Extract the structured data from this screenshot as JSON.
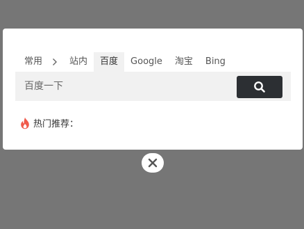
{
  "background": {
    "blurred_title": ""
  },
  "search_engine_panel": {
    "tabs": [
      {
        "label": "常用",
        "active": false,
        "group": true
      },
      {
        "label": "站内",
        "active": false
      },
      {
        "label": "百度",
        "active": true
      },
      {
        "label": "Google",
        "active": false
      },
      {
        "label": "淘宝",
        "active": false
      },
      {
        "label": "Bing",
        "active": false
      }
    ],
    "search": {
      "placeholder": "百度一下",
      "value": "",
      "button_icon": "search-icon"
    },
    "hot": {
      "icon": "fire-icon",
      "label": "热门推荐："
    }
  },
  "close_button": {
    "icon": "close-icon"
  },
  "colors": {
    "overlay": "#767676",
    "panel": "#ffffff",
    "active_tab": "#f1f1f1",
    "search_button": "#2c2f33",
    "fire": "#f05a4b"
  }
}
